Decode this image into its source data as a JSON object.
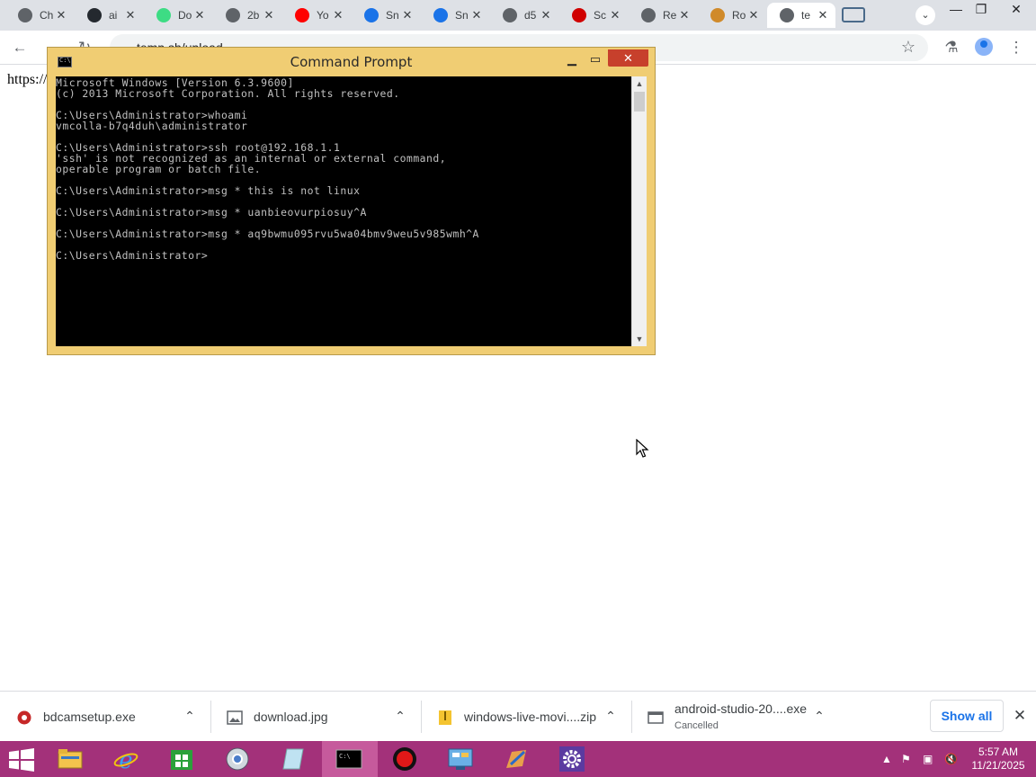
{
  "browser": {
    "tabs": [
      {
        "label": "Ch",
        "icon": "chrome-icon",
        "color": "#5f6368"
      },
      {
        "label": "ai",
        "icon": "github-icon",
        "color": "#24292f"
      },
      {
        "label": "Do",
        "icon": "android-icon",
        "color": "#3ddc84"
      },
      {
        "label": "2b",
        "icon": "globe-icon",
        "color": "#5f6368"
      },
      {
        "label": "Yo",
        "icon": "youtube-icon",
        "color": "#ff0000"
      },
      {
        "label": "Sn",
        "icon": "snap-icon",
        "color": "#1a73e8"
      },
      {
        "label": "Sn",
        "icon": "snap-icon",
        "color": "#1a73e8"
      },
      {
        "label": "d5",
        "icon": "globe-icon",
        "color": "#5f6368"
      },
      {
        "label": "Sc",
        "icon": "record-icon",
        "color": "#d00000"
      },
      {
        "label": "Re",
        "icon": "globe-icon",
        "color": "#5f6368"
      },
      {
        "label": "Ro",
        "icon": "roblox-icon",
        "color": "#d08a2a"
      },
      {
        "label": "te",
        "icon": "globe-icon",
        "color": "#5f6368",
        "active": true
      }
    ],
    "url": "temp.sh/upload",
    "page_text": "https://"
  },
  "cmd": {
    "title": "Command Prompt",
    "lines": [
      "Microsoft Windows [Version 6.3.9600]",
      "(c) 2013 Microsoft Corporation. All rights reserved.",
      "",
      "C:\\Users\\Administrator>whoami",
      "vmcolla-b7q4duh\\administrator",
      "",
      "C:\\Users\\Administrator>ssh root@192.168.1.1",
      "'ssh' is not recognized as an internal or external command,",
      "operable program or batch file.",
      "",
      "C:\\Users\\Administrator>msg * this is not linux",
      "",
      "C:\\Users\\Administrator>msg * uanbieovurpiosuy^A",
      "",
      "C:\\Users\\Administrator>msg * aq9bwmu095rvu5wa04bmv9weu5v985wmh^A",
      "",
      "C:\\Users\\Administrator>"
    ]
  },
  "downloads": {
    "items": [
      {
        "name": "bdcamsetup.exe",
        "status": ""
      },
      {
        "name": "download.jpg",
        "status": ""
      },
      {
        "name": "windows-live-movi....zip",
        "status": ""
      },
      {
        "name": "android-studio-20....exe",
        "status": "Cancelled"
      }
    ],
    "show_all": "Show all"
  },
  "taskbar": {
    "time": "5:57 AM",
    "date": "11/21/2025",
    "accent": "#a3317a"
  }
}
